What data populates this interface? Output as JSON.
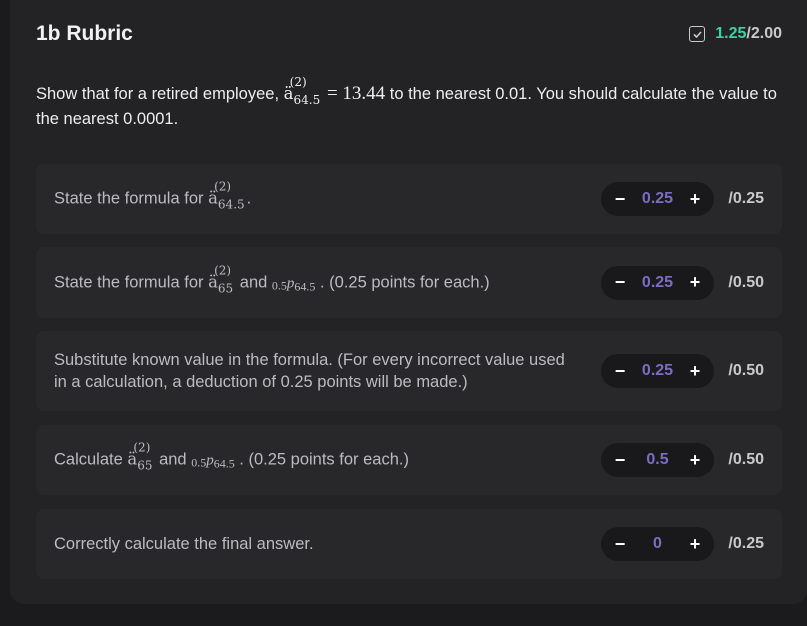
{
  "header": {
    "title": "1b Rubric",
    "score_earned": "1.25",
    "score_total": "/2.00",
    "status_icon": "checkbox-icon"
  },
  "question": {
    "text_before": "Show that for a retired employee, ",
    "symbol": "ä",
    "symbol_sup": "(2)",
    "symbol_sub": "64.5",
    "equation": " = 13.44",
    "text_after": " to the nearest 0.01. You should calculate the value to the nearest 0.0001."
  },
  "items": [
    {
      "text_before": "State the formula for ",
      "symbol": "ä",
      "symbol_sup": "(2)",
      "symbol_sub": "64.5",
      "text_after": ".",
      "value": "0.25",
      "max": "/0.25"
    },
    {
      "text_before": "State the formula for ",
      "symbol": "ä",
      "symbol_sup": "(2)",
      "symbol_sub": "65",
      "text_mid": " and ",
      "p_pre": "0.5",
      "p_letter": "p",
      "p_sub": "64.5",
      "text_after": " . (0.25 points for each.)",
      "value": "0.25",
      "max": "/0.50"
    },
    {
      "text": "Substitute known value in the formula. (For every incorrect value used in a calculation, a deduction of 0.25 points will be made.)",
      "value": "0.25",
      "max": "/0.50"
    },
    {
      "text_before": "Calculate ",
      "symbol": "ä",
      "symbol_sup": "(2)",
      "symbol_sub": "65",
      "text_mid": " and ",
      "p_pre": "0.5",
      "p_letter": "p",
      "p_sub": "64.5",
      "text_after": " . (0.25 points for each.)",
      "value": "0.5",
      "max": "/0.50"
    },
    {
      "text": "Correctly calculate the final answer.",
      "value": "0",
      "max": "/0.25"
    }
  ],
  "controls": {
    "minus": "−",
    "plus": "+"
  },
  "colors": {
    "earned": "#3ed2a0",
    "value": "#7c6cc4",
    "panel": "#232325",
    "item": "#28282b"
  }
}
